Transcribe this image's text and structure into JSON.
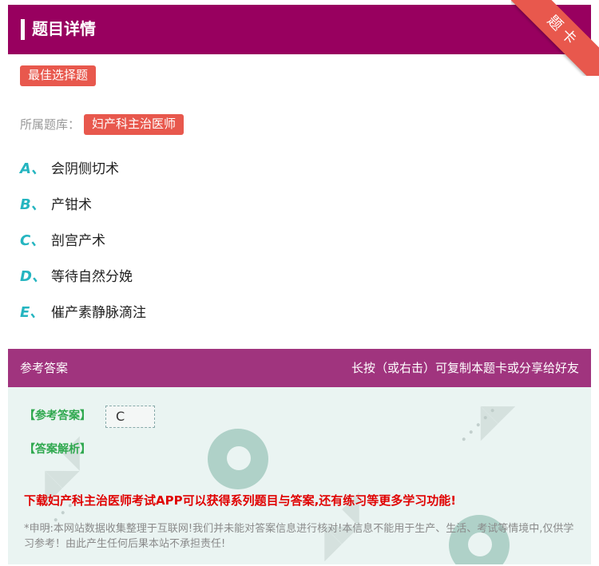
{
  "header": {
    "title": "题目详情"
  },
  "corner_ribbon": {
    "label": "题卡"
  },
  "question_type": "最佳选择题",
  "question_bank": {
    "label": "所属题库：",
    "value": "妇产科主治医师"
  },
  "options": [
    {
      "letter": "A、",
      "text": "会阴侧切术"
    },
    {
      "letter": "B、",
      "text": "产钳术"
    },
    {
      "letter": "C、",
      "text": "剖宫产术"
    },
    {
      "letter": "D、",
      "text": "等待自然分娩"
    },
    {
      "letter": "E、",
      "text": "催产素静脉滴注"
    }
  ],
  "answer_section": {
    "left_label": "参考答案",
    "right_hint": "长按（或右击）可复制本题卡或分享给好友",
    "reference_answer_label": "【参考答案】",
    "reference_answer_value": "C",
    "analysis_label": "【答案解析】",
    "promo": "下载妇产科主治医师考试APP可以获得系列题目与答案,还有练习等更多学习功能!",
    "disclaimer": "*申明:本网站数据收集整理于互联网!我们并未能对答案信息进行核对!本信息不能用于生产、生活、考试等情境中,仅供学习参考！由此产生任何后果本站不承担责任!"
  },
  "colors": {
    "header_bg": "#98005f",
    "answer_bar_bg": "#a0347e",
    "tag_bg": "#e8584d",
    "option_letter": "#25b5c0",
    "answer_label": "#2fa84f",
    "promo_text": "#e00000"
  }
}
